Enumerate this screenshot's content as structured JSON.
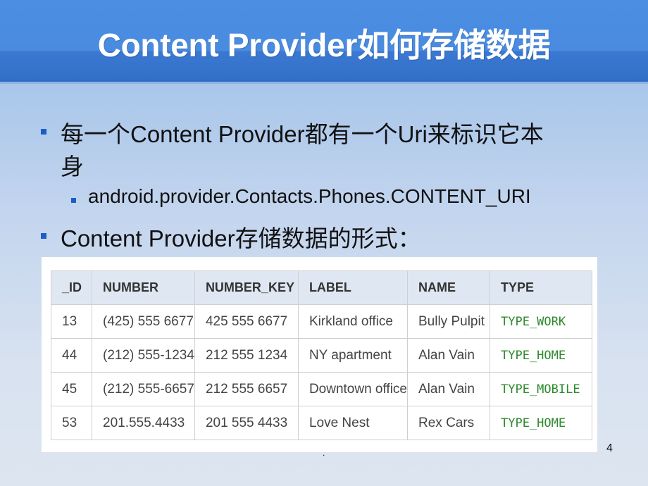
{
  "slide": {
    "title": "Content Provider如何存储数据",
    "bullets": [
      {
        "level": 1,
        "text_line1": "每一个Content Provider都有一个Uri来标识它本",
        "text_line2": "身"
      },
      {
        "level": 2,
        "text": "android.provider.Contacts.Phones.CONTENT_URI"
      },
      {
        "level": 1,
        "text": "Content Provider存储数据的形式："
      }
    ],
    "footer_mark": ".",
    "page_number": "4"
  },
  "table": {
    "columns": [
      "_ID",
      "NUMBER",
      "NUMBER_KEY",
      "LABEL",
      "NAME",
      "TYPE"
    ],
    "rows": [
      [
        "13",
        "(425) 555 6677",
        "425 555 6677",
        "Kirkland office",
        "Bully Pulpit",
        "TYPE_WORK"
      ],
      [
        "44",
        "(212) 555-1234",
        "212 555 1234",
        "NY apartment",
        "Alan Vain",
        "TYPE_HOME"
      ],
      [
        "45",
        "(212) 555-6657",
        "212 555 6657",
        "Downtown office",
        "Alan Vain",
        "TYPE_MOBILE"
      ],
      [
        "53",
        "201.555.4433",
        "201 555 4433",
        "Love Nest",
        "Rex Cars",
        "TYPE_HOME"
      ]
    ]
  },
  "colors": {
    "header_blue": "#4a8be0",
    "header_band": "#3270c8",
    "bullet": "#1a5fc7",
    "type_green": "#2d8a2d",
    "table_header_bg": "#dfe8f2"
  }
}
